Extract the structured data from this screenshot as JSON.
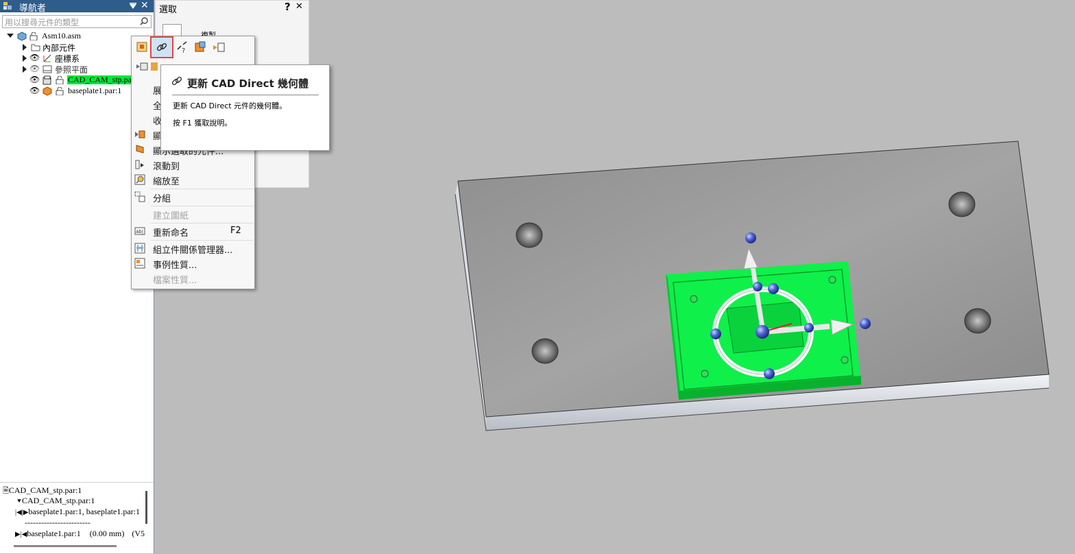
{
  "navigator": {
    "title": "導航者",
    "search_placeholder": "用以搜尋元件的類型",
    "tree": {
      "root": "Asm10.asm",
      "internal": "內部元件",
      "coord": "座標系",
      "ref_planes": "參照平面",
      "part1": "CAD_CAM_stp.par:1",
      "part2": "baseplate1.par:1"
    },
    "relations": {
      "header": "CAD_CAM_stp.par:1",
      "item1": "CAD_CAM_stp.par:1",
      "item2": "baseplate1.par:1, baseplate1.par:1",
      "dashes": "------------------------",
      "item3_name": "baseplate1.par:1",
      "item3_val": "(0.00 mm)",
      "item3_more": "(V5"
    }
  },
  "select_panel": {
    "title": "選取",
    "help": "?",
    "close": "✕",
    "copy_label": "複製"
  },
  "context_menu": {
    "items_partial": [
      "展",
      "全",
      "收",
      "顯",
      "顯示選取的元件..."
    ],
    "scroll_to": "滾動到",
    "zoom_to": "縮放至",
    "group": "分組",
    "create_drawing": "建立圖紙",
    "rename": "重新命名",
    "rename_key": "F2",
    "relationship_mgr": "組立件關係管理器...",
    "occurrence_props": "事例性質...",
    "file_props": "檔案性質..."
  },
  "tooltip": {
    "title": "更新 CAD Direct 幾何體",
    "description": "更新 CAD Direct 元件的幾何體。",
    "help_hint": "按 F1 獲取說明。"
  },
  "colors": {
    "nav_title_bg": "#2e5d8c",
    "selection_green": "#00e83a",
    "plate_gray": "#9a9a9a",
    "background": "#bcbcbc"
  }
}
